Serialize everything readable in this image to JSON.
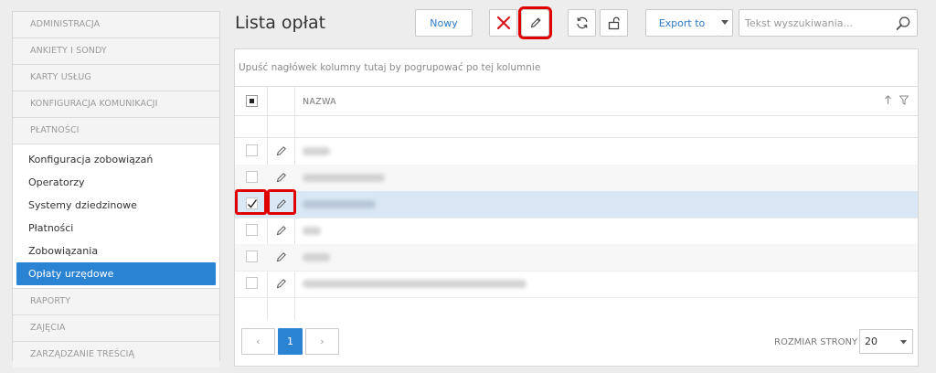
{
  "sidebar": {
    "sections_top": [
      "ADMINISTRACJA",
      "ANKIETY I SONDY",
      "KARTY USŁUG",
      "KONFIGURACJA KOMUNIKACJI",
      "PŁATNOŚCI"
    ],
    "payments_items": [
      "Konfiguracja zobowiązań",
      "Operatorzy",
      "Systemy dziedzinowe",
      "Płatności",
      "Zobowiązania",
      "Opłaty urzędowe"
    ],
    "active_item": "Opłaty urzędowe",
    "sections_bottom": [
      "RAPORTY",
      "ZAJĘCIA",
      "ZARZĄDZANIE TREŚCIĄ"
    ]
  },
  "header": {
    "title": "Lista opłat",
    "new_label": "Nowy",
    "export_label": "Export to",
    "search_placeholder": "Tekst wyszukiwania..."
  },
  "grid": {
    "group_hint": "Upuść nagłówek kolumny tutaj by pogrupować po tej kolumnie",
    "column_name": "NAZWA",
    "rows": [
      {
        "checked": false,
        "selected": false
      },
      {
        "checked": false,
        "selected": false
      },
      {
        "checked": true,
        "selected": true
      },
      {
        "checked": false,
        "selected": false
      },
      {
        "checked": false,
        "selected": false
      },
      {
        "checked": false,
        "selected": false
      }
    ]
  },
  "pager": {
    "prev": "‹",
    "current_page": "1",
    "next": "›",
    "page_size_label": "ROZMIAR STRONY",
    "page_size": "20"
  },
  "colors": {
    "accent": "#2b83d3",
    "highlight": "#e00000",
    "delete": "#d9161c",
    "selected_row": "#dae8f5"
  }
}
